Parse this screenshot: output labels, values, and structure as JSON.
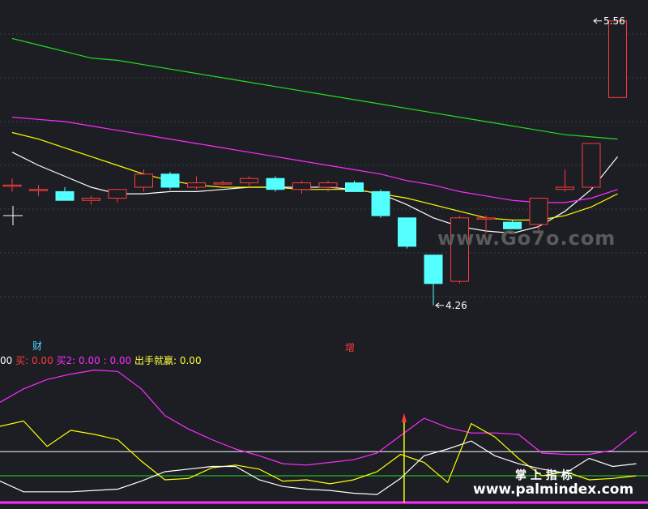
{
  "indicator_bar": {
    "prefix": "00",
    "buy_label": "买:",
    "buy_value": "0.00",
    "buy2_label": "买2:",
    "buy2_value": "0.00 : 0.00",
    "exit_label": "出手就赢:",
    "exit_value": "0.00"
  },
  "markers": {
    "left_label": "财",
    "mid_label": "增"
  },
  "watermarks": {
    "top": "www.Go7o.com",
    "bottom_cn": "掌 上 指 标",
    "bottom_url": "www.palmindex.com"
  },
  "colors": {
    "background": "#1c1e24",
    "up": "#ff3b3b",
    "down": "#54ffff",
    "ma_white": "#ffffff",
    "ma_yellow": "#ffff00",
    "ma_magenta": "#ff2bff",
    "ma_green": "#22dd22"
  },
  "chart_data": [
    {
      "type": "candlestick",
      "title": "",
      "ylim": [
        4.1,
        5.6
      ],
      "grid": true,
      "annotations": [
        {
          "label": "5.56",
          "value": 5.56,
          "candle": 22
        },
        {
          "label": "4.26",
          "value": 4.26,
          "candle": 16
        }
      ],
      "candles": [
        {
          "open": 4.81,
          "high": 4.84,
          "low": 4.78,
          "close": 4.81
        },
        {
          "open": 4.79,
          "high": 4.81,
          "low": 4.76,
          "close": 4.79
        },
        {
          "open": 4.78,
          "high": 4.8,
          "low": 4.74,
          "close": 4.74
        },
        {
          "open": 4.74,
          "high": 4.76,
          "low": 4.72,
          "close": 4.75
        },
        {
          "open": 4.75,
          "high": 4.79,
          "low": 4.73,
          "close": 4.79
        },
        {
          "open": 4.8,
          "high": 4.88,
          "low": 4.78,
          "close": 4.86
        },
        {
          "open": 4.86,
          "high": 4.87,
          "low": 4.79,
          "close": 4.8
        },
        {
          "open": 4.8,
          "high": 4.85,
          "low": 4.79,
          "close": 4.82
        },
        {
          "open": 4.82,
          "high": 4.83,
          "low": 4.81,
          "close": 4.82
        },
        {
          "open": 4.82,
          "high": 4.85,
          "low": 4.8,
          "close": 4.84
        },
        {
          "open": 4.84,
          "high": 4.85,
          "low": 4.78,
          "close": 4.79
        },
        {
          "open": 4.79,
          "high": 4.83,
          "low": 4.77,
          "close": 4.82
        },
        {
          "open": 4.8,
          "high": 4.83,
          "low": 4.78,
          "close": 4.82
        },
        {
          "open": 4.82,
          "high": 4.83,
          "low": 4.78,
          "close": 4.78
        },
        {
          "open": 4.78,
          "high": 4.79,
          "low": 4.66,
          "close": 4.67
        },
        {
          "open": 4.66,
          "high": 4.66,
          "low": 4.52,
          "close": 4.53
        },
        {
          "open": 4.49,
          "high": 4.49,
          "low": 4.26,
          "close": 4.36
        },
        {
          "open": 4.37,
          "high": 4.67,
          "low": 4.36,
          "close": 4.66
        },
        {
          "open": 4.66,
          "high": 4.67,
          "low": 4.59,
          "close": 4.66
        },
        {
          "open": 4.64,
          "high": 4.65,
          "low": 4.61,
          "close": 4.61
        },
        {
          "open": 4.63,
          "high": 4.75,
          "low": 4.6,
          "close": 4.75
        },
        {
          "open": 4.79,
          "high": 4.88,
          "low": 4.78,
          "close": 4.8
        },
        {
          "open": 4.8,
          "high": 5.0,
          "low": 4.79,
          "close": 5.0
        },
        {
          "open": 5.21,
          "high": 5.56,
          "low": 5.21,
          "close": 5.56
        }
      ],
      "moving_averages": [
        {
          "color": "white",
          "values": [
            4.96,
            4.9,
            4.85,
            4.8,
            4.77,
            4.77,
            4.78,
            4.78,
            4.79,
            4.8,
            4.8,
            4.8,
            4.8,
            4.79,
            4.77,
            4.72,
            4.66,
            4.62,
            4.6,
            4.59,
            4.62,
            4.69,
            4.79,
            4.94
          ]
        },
        {
          "color": "yellow",
          "values": [
            5.05,
            5.02,
            4.98,
            4.94,
            4.9,
            4.86,
            4.83,
            4.81,
            4.8,
            4.8,
            4.8,
            4.79,
            4.79,
            4.79,
            4.77,
            4.75,
            4.72,
            4.69,
            4.66,
            4.65,
            4.65,
            4.67,
            4.71,
            4.77
          ]
        },
        {
          "color": "magenta",
          "values": [
            5.12,
            5.11,
            5.1,
            5.08,
            5.06,
            5.04,
            5.02,
            5.0,
            4.98,
            4.96,
            4.94,
            4.92,
            4.9,
            4.88,
            4.86,
            4.83,
            4.81,
            4.78,
            4.76,
            4.74,
            4.73,
            4.73,
            4.75,
            4.79
          ]
        },
        {
          "color": "green",
          "values": [
            5.48,
            5.45,
            5.42,
            5.39,
            5.38,
            5.36,
            5.34,
            5.32,
            5.3,
            5.28,
            5.26,
            5.24,
            5.22,
            5.2,
            5.18,
            5.16,
            5.14,
            5.12,
            5.1,
            5.08,
            5.06,
            5.04,
            5.03,
            5.02
          ]
        }
      ]
    },
    {
      "type": "line",
      "title": "",
      "ylim": [
        0,
        100
      ],
      "reference_lines": [
        {
          "value": 38,
          "color": "white"
        },
        {
          "value": 20,
          "color": "green"
        },
        {
          "value": 0,
          "color": "magenta"
        }
      ],
      "series": [
        {
          "color": "magenta",
          "values": [
            75,
            85,
            92,
            96,
            99,
            98,
            85,
            65,
            55,
            47,
            40,
            35,
            29,
            28,
            30,
            32,
            37,
            50,
            63,
            56,
            52,
            52,
            51,
            37,
            36,
            36,
            39,
            53
          ]
        },
        {
          "color": "yellow",
          "values": [
            57,
            61,
            42,
            54,
            51,
            47,
            31,
            17,
            18,
            26,
            28,
            25,
            16,
            17,
            14,
            17,
            23,
            36,
            30,
            15,
            59,
            49,
            33,
            20,
            23,
            17,
            18,
            20
          ]
        },
        {
          "color": "white",
          "values": [
            16,
            8,
            8,
            8,
            9,
            10,
            16,
            23,
            25,
            27,
            27,
            17,
            12,
            10,
            9,
            7,
            6,
            18,
            35,
            40,
            46,
            35,
            29,
            25,
            22,
            33,
            27,
            29
          ]
        }
      ],
      "signal": {
        "index": 16,
        "color": "yellow"
      }
    }
  ]
}
